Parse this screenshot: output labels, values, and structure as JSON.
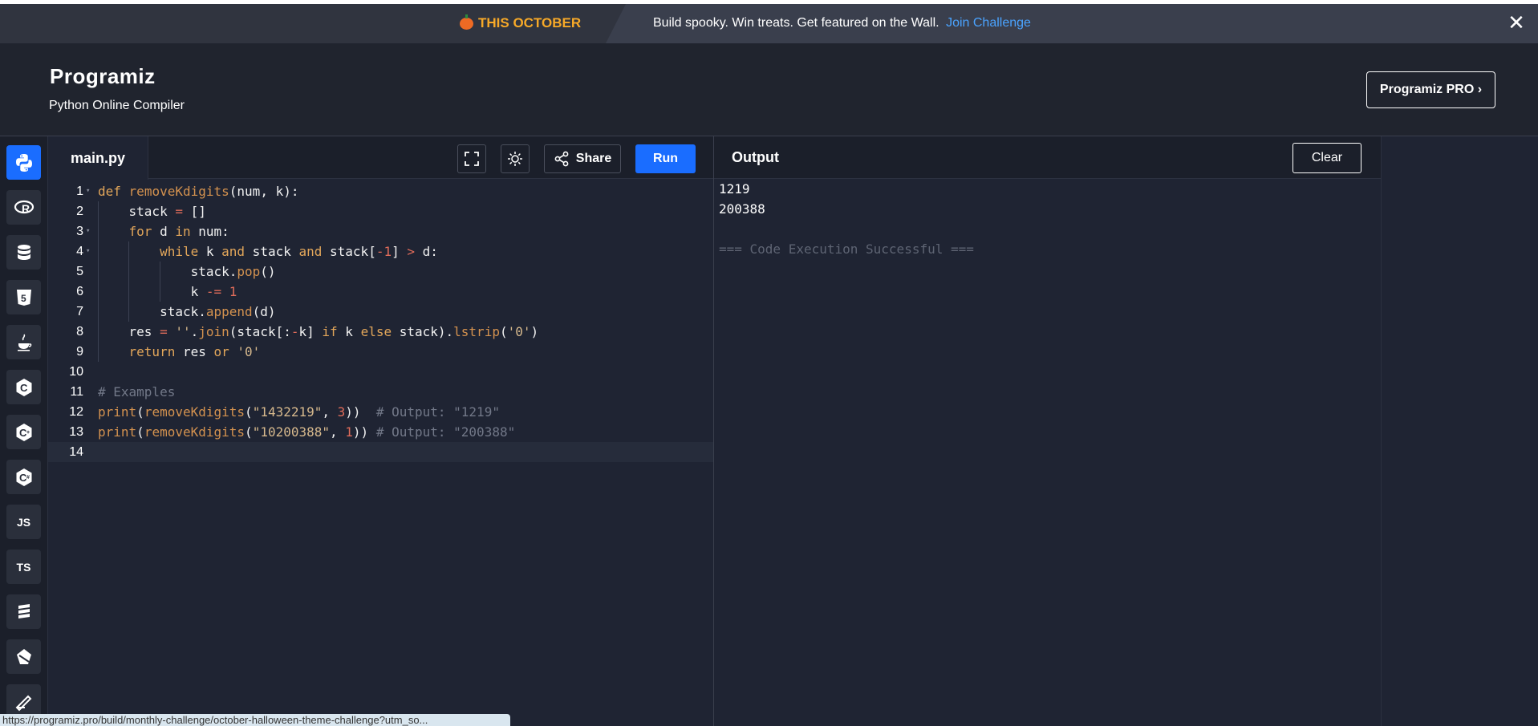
{
  "promo": {
    "tag": "THIS OCTOBER",
    "message": "Build spooky. Win treats. Get featured on the Wall.",
    "link": "Join Challenge",
    "close": "✕"
  },
  "header": {
    "logo": "Programiz",
    "subtitle": "Python Online Compiler",
    "pro_button": "Programiz PRO ›"
  },
  "sidebar": {
    "languages": [
      {
        "icon": "python-icon",
        "label": "",
        "active": true
      },
      {
        "icon": "r-icon",
        "label": "R"
      },
      {
        "icon": "sql-icon",
        "label": ""
      },
      {
        "icon": "html5-icon",
        "label": "5"
      },
      {
        "icon": "java-icon",
        "label": ""
      },
      {
        "icon": "c-icon",
        "label": "C"
      },
      {
        "icon": "cpp-icon",
        "label": "C"
      },
      {
        "icon": "csharp-icon",
        "label": "C"
      },
      {
        "icon": "javascript-icon",
        "label": "JS"
      },
      {
        "icon": "typescript-icon",
        "label": "TS"
      },
      {
        "icon": "go-icon",
        "label": ""
      },
      {
        "icon": "php-icon",
        "label": ""
      },
      {
        "icon": "swift-icon",
        "label": ""
      }
    ]
  },
  "editor": {
    "filename": "main.py",
    "share_label": "Share",
    "run_label": "Run",
    "current_line": 14,
    "lines": [
      "def removeKdigits(num, k):",
      "    stack = []",
      "    for d in num:",
      "        while k and stack and stack[-1] > d:",
      "            stack.pop()",
      "            k -= 1",
      "        stack.append(d)",
      "    res = ''.join(stack[:-k] if k else stack).lstrip('0')",
      "    return res or '0'",
      "",
      "# Examples",
      "print(removeKdigits(\"1432219\", 3))  # Output: \"1219\"",
      "print(removeKdigits(\"10200388\", 1)) # Output: \"200388\"",
      ""
    ]
  },
  "output": {
    "title": "Output",
    "clear_label": "Clear",
    "lines": [
      "1219",
      "200388",
      "",
      "=== Code Execution Successful ==="
    ]
  },
  "status_url": "https://programiz.pro/build/monthly-challenge/october-halloween-theme-challenge?utm_so..."
}
